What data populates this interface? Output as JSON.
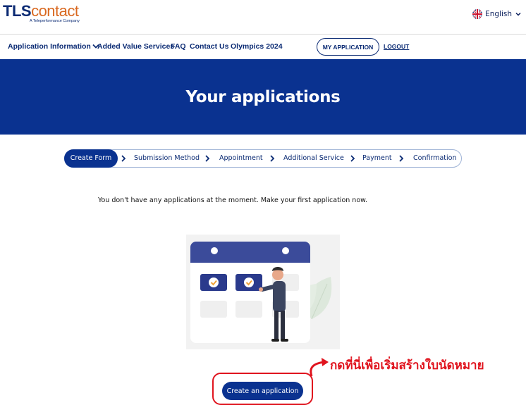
{
  "header": {
    "logo": {
      "brand_tls": "TLS",
      "brand_contact": "contact",
      "tagline": "A Teleperformance Company"
    },
    "language": {
      "label": "English",
      "flag_icon": "uk-flag-icon"
    }
  },
  "nav": {
    "items": [
      {
        "label": "Application Information"
      },
      {
        "label": "Added Value Services"
      },
      {
        "label": "FAQ"
      },
      {
        "label": "Contact Us"
      },
      {
        "label": "Olympics 2024"
      }
    ],
    "my_application": "MY APPLICATION",
    "logout": "LOGOUT"
  },
  "hero": {
    "title": "Your applications"
  },
  "steps": {
    "items": [
      {
        "label": "Create Form",
        "active": true
      },
      {
        "label": "Submission Method"
      },
      {
        "label": "Appointment"
      },
      {
        "label": "Additional Service"
      },
      {
        "label": "Payment"
      },
      {
        "label": "Confirmation"
      }
    ]
  },
  "main": {
    "empty_message": "You don't have any applications at the moment. Make your first application now.",
    "illustration": "calendar-person-illustration",
    "create_button": "Create an application"
  },
  "annotation": {
    "text": "กดที่นี่เพื่อเริ่มสร้างใบนัดหมาย"
  },
  "colors": {
    "brand_blue": "#0a3290",
    "accent_orange": "#d9681f",
    "annotation_red": "#e0141e"
  }
}
